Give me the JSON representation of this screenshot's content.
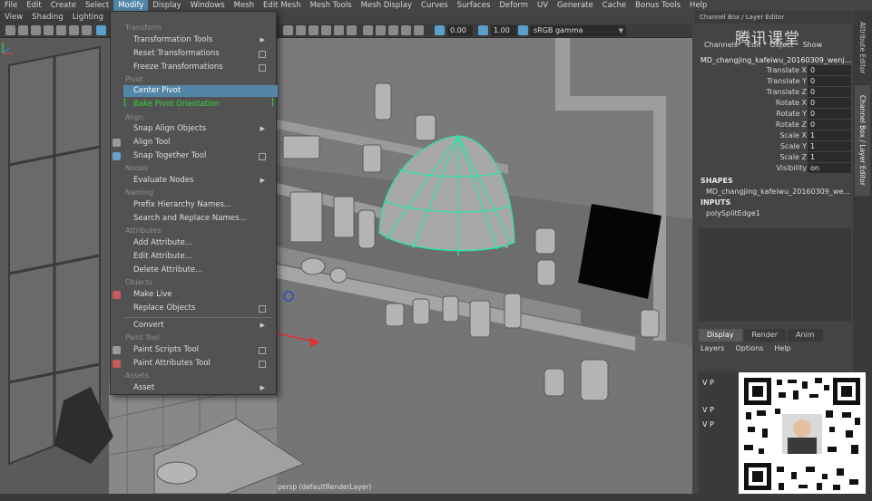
{
  "menubar": {
    "items": [
      "File",
      "Edit",
      "Create",
      "Select",
      "Modify",
      "Display",
      "Windows",
      "Mesh",
      "Edit Mesh",
      "Mesh Tools",
      "Mesh Display",
      "Curves",
      "Surfaces",
      "Deform",
      "UV",
      "Generate",
      "Cache",
      "Bonus Tools",
      "Help"
    ],
    "active": "Modify"
  },
  "panel_menu": [
    "View",
    "Shading",
    "Lighting"
  ],
  "toolbar": {
    "gamma_value": "0.00",
    "exposure_value": "1.00",
    "color_space": "sRGB gamma"
  },
  "modify_menu": {
    "sections": {
      "transform": "Transform",
      "pivot": "Pivot",
      "align": "Align",
      "nodes": "Nodes",
      "naming": "Naming",
      "attributes": "Attributes",
      "objects": "Objects",
      "paint_tool": "Paint Tool",
      "assets": "Assets"
    },
    "items": {
      "transformation_tools": "Transformation Tools",
      "reset_transformations": "Reset Transformations",
      "freeze_transformations": "Freeze Transformations",
      "center_pivot": "Center Pivot",
      "bake_pivot": "Bake Pivot Orientation",
      "snap_align": "Snap Align Objects",
      "align_tool": "Align Tool",
      "snap_together": "Snap Together Tool",
      "evaluate_nodes": "Evaluate Nodes",
      "prefix_hierarchy": "Prefix Hierarchy Names...",
      "search_replace": "Search and Replace Names...",
      "add_attribute": "Add Attribute...",
      "edit_attribute": "Edit Attribute...",
      "delete_attribute": "Delete Attribute...",
      "make_live": "Make Live",
      "replace_objects": "Replace Objects",
      "convert": "Convert",
      "paint_scripts": "Paint Scripts Tool",
      "paint_attributes": "Paint Attributes Tool",
      "asset": "Asset"
    }
  },
  "viewport": {
    "label": "persp (defaultRenderLayer)"
  },
  "channel_box": {
    "header": "Channel Box / Layer Editor",
    "menus": [
      "Channels",
      "Edit",
      "Object",
      "Show"
    ],
    "watermark": "腾讯课堂",
    "object_name": "MD_changjing_kafeiwu_20160309_wenj...",
    "attributes": [
      {
        "label": "Translate X",
        "value": "0"
      },
      {
        "label": "Translate Y",
        "value": "0"
      },
      {
        "label": "Translate Z",
        "value": "0"
      },
      {
        "label": "Rotate X",
        "value": "0"
      },
      {
        "label": "Rotate Y",
        "value": "0"
      },
      {
        "label": "Rotate Z",
        "value": "0"
      },
      {
        "label": "Scale X",
        "value": "1"
      },
      {
        "label": "Scale Y",
        "value": "1"
      },
      {
        "label": "Scale Z",
        "value": "1"
      },
      {
        "label": "Visibility",
        "value": "on"
      }
    ],
    "shapes_header": "SHAPES",
    "shapes_item": "MD_changjing_kafeiwu_20160309_we...",
    "inputs_header": "INPUTS",
    "inputs_item": "polySplitEdge1"
  },
  "layer_editor": {
    "tabs": [
      "Display",
      "Render",
      "Anim"
    ],
    "active_tab": "Display",
    "menus": [
      "Layers",
      "Options",
      "Help"
    ],
    "rows": [
      "V P",
      "V P",
      "V P"
    ]
  },
  "side_tabs": [
    "Attribute Editor",
    "Channel Box / Layer Editor"
  ]
}
